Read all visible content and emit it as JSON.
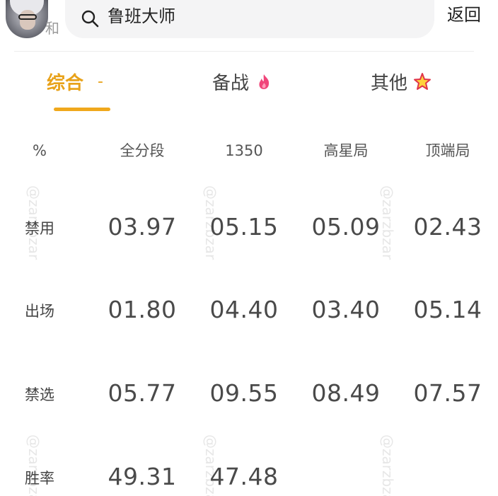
{
  "header": {
    "user_name": "和",
    "search_text": "鲁班大师",
    "back_label": "返回"
  },
  "tabs": [
    {
      "label": "综合",
      "suffix": "-",
      "active": true
    },
    {
      "label": "备战",
      "icon": "flame-icon",
      "active": false
    },
    {
      "label": "其他",
      "icon": "star-icon",
      "active": false
    }
  ],
  "table": {
    "columns": [
      "%",
      "全分段",
      "1350",
      "高星局",
      "顶端局"
    ],
    "rows": [
      {
        "label": "禁用",
        "values": [
          "03.97",
          "05.15",
          "05.09",
          "02.43"
        ]
      },
      {
        "label": "出场",
        "values": [
          "01.80",
          "04.40",
          "03.40",
          "05.14"
        ]
      },
      {
        "label": "禁选",
        "values": [
          "05.77",
          "09.55",
          "08.49",
          "07.57"
        ]
      },
      {
        "label": "胜率",
        "values": [
          "49.31",
          "47.48",
          "",
          ""
        ]
      }
    ]
  },
  "watermark": "@zarzbzar",
  "colors": {
    "accent": "#f0a81c",
    "active_tab_text": "#e8a21a"
  }
}
